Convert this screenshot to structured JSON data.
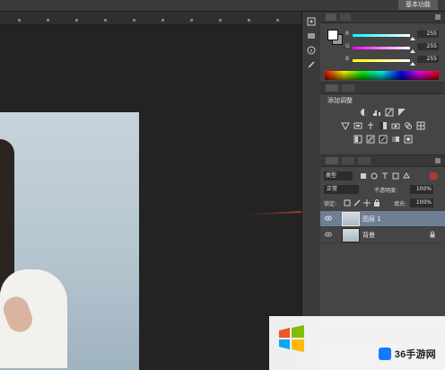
{
  "app": {
    "workspace_label": "基本功能"
  },
  "color_panel": {
    "sliders": [
      {
        "label": "R",
        "value": "255"
      },
      {
        "label": "G",
        "value": "255"
      },
      {
        "label": "B",
        "value": "255"
      }
    ]
  },
  "adjustments_panel": {
    "title": "添加调整"
  },
  "layers_panel": {
    "kind": "类型",
    "blend_mode": "正常",
    "opacity_label": "不透明度:",
    "opacity_value": "100%",
    "lock_label": "锁定:",
    "fill_label": "填充:",
    "fill_value": "100%",
    "layers": [
      {
        "name": "图层 1",
        "selected": true
      },
      {
        "name": "背景",
        "selected": false,
        "locked": true
      }
    ]
  },
  "watermark": {
    "brand_text": "36手游网"
  },
  "colors": {
    "accent_arrow": "#e04a3b",
    "layer_selected": "#6f7f93",
    "brand_blue": "#1677ff"
  }
}
